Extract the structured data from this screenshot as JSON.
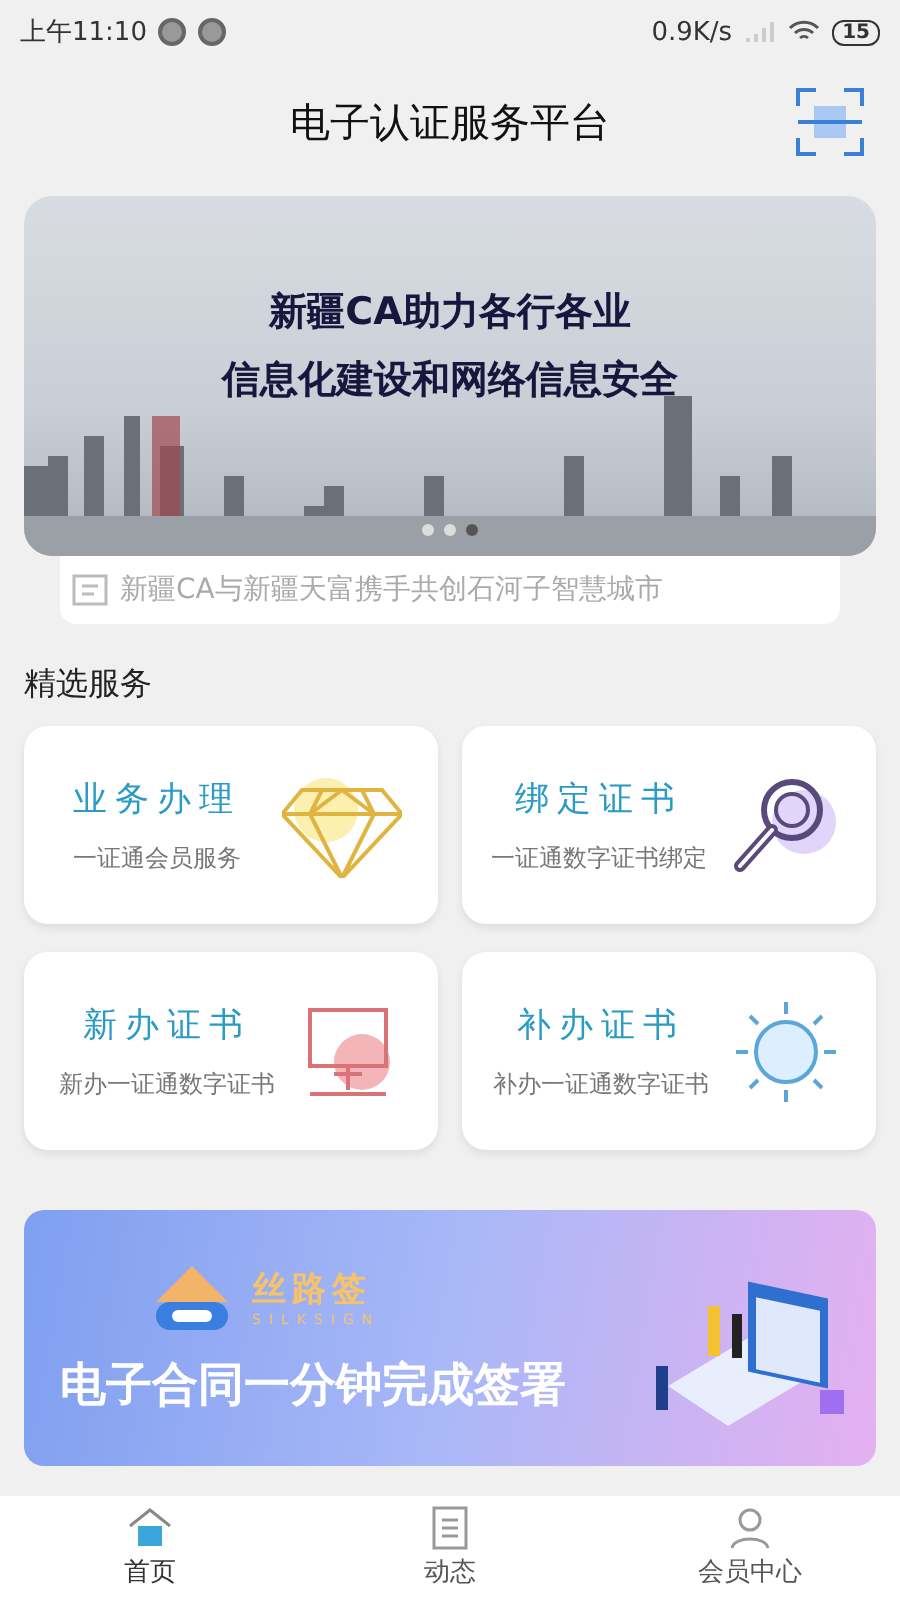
{
  "status_bar": {
    "time": "上午11:10",
    "speed": "0.9K/s",
    "battery": "15"
  },
  "header": {
    "title": "电子认证服务平台"
  },
  "banner": {
    "lines": [
      "新疆CA助力各行各业",
      "信息化建设和网络信息安全"
    ],
    "dots": [
      {
        "selected": false
      },
      {
        "selected": false
      },
      {
        "selected": true
      }
    ]
  },
  "news": [
    "新疆CA与新疆天富携手共创石河子智慧城市"
  ],
  "section_title": "精选服务",
  "services": [
    {
      "title": "业务办理",
      "subtitle": "一证通会员服务",
      "kind": "diamond"
    },
    {
      "title": "绑定证书",
      "subtitle": "一证通数字证书绑定",
      "kind": "magnifier"
    },
    {
      "title": "新办证书",
      "subtitle": "新办一证通数字证书",
      "kind": "monitor"
    },
    {
      "title": "补办证书",
      "subtitle": "补办一证通数字证书",
      "kind": "sun"
    }
  ],
  "promo": {
    "logo": "丝路签",
    "logo_sub": "SILKSIGN",
    "text": "电子合同一分钟完成签署"
  },
  "tabs": [
    {
      "label": "首页",
      "kind": "home",
      "selected": true
    },
    {
      "label": "动态",
      "kind": "list",
      "selected": false
    },
    {
      "label": "会员中心",
      "kind": "user",
      "selected": false
    }
  ]
}
